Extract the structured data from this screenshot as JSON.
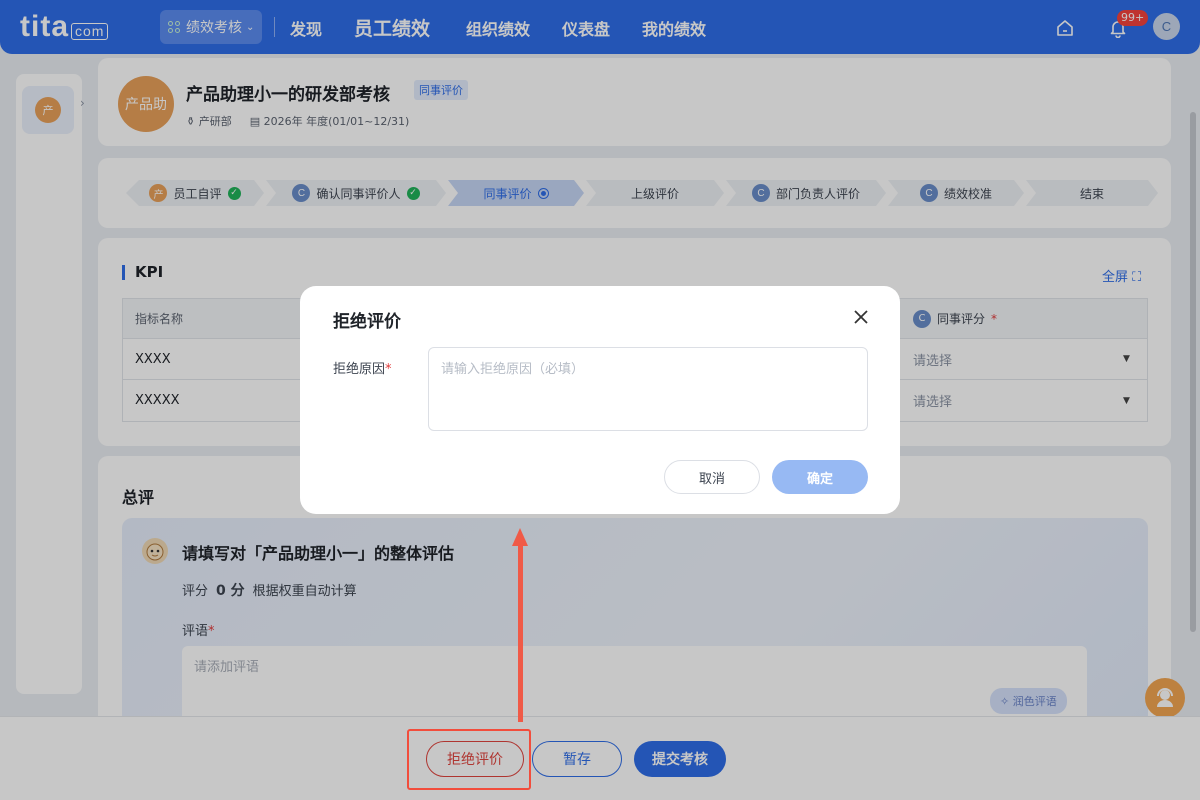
{
  "topnav": {
    "logo_text": "tita",
    "logo_suffix": "com",
    "switcher_label": "绩效考核",
    "items": [
      "发现",
      "员工绩效",
      "组织绩效",
      "仪表盘",
      "我的绩效"
    ],
    "notification_count": "99+",
    "user_initial": "C"
  },
  "sidebar": {
    "item_label": "产"
  },
  "header": {
    "avatar_text": "产品助",
    "title": "产品助理小一的研发部考核",
    "tag": "同事评价",
    "department": "产研部",
    "period": "2026年 年度(01/01~12/31)"
  },
  "steps": [
    {
      "label": "员工自评",
      "avatar": "产",
      "avatar_type": "orange",
      "status": "done"
    },
    {
      "label": "确认同事评价人",
      "avatar": "C",
      "avatar_type": "blue",
      "status": "done"
    },
    {
      "label": "同事评价",
      "avatar": "",
      "avatar_type": "none",
      "status": "active"
    },
    {
      "label": "上级评价",
      "avatar": "",
      "avatar_type": "none",
      "status": "pending"
    },
    {
      "label": "部门负责人评价",
      "avatar": "C",
      "avatar_type": "blue",
      "status": "pending"
    },
    {
      "label": "绩效校准",
      "avatar": "C",
      "avatar_type": "blue",
      "status": "pending"
    },
    {
      "label": "结束",
      "avatar": "",
      "avatar_type": "none",
      "status": "pending"
    }
  ],
  "kpi": {
    "title": "KPI",
    "fullscreen_label": "全屏",
    "columns": {
      "name": "指标名称",
      "score": "同事评分",
      "score_avatar": "C"
    },
    "rows": [
      {
        "name": "XXXX",
        "score_placeholder": "请选择"
      },
      {
        "name": "XXXXX",
        "score_placeholder": "请选择"
      }
    ]
  },
  "summary": {
    "title": "总评",
    "panel_title": "请填写对「产品助理小一」的整体评估",
    "score_label": "评分",
    "score_value": "0 分",
    "score_note": "根据权重自动计算",
    "comment_label": "评语",
    "comment_placeholder": "请添加评语",
    "polish_label": "润色评语"
  },
  "footer": {
    "reject_label": "拒绝评价",
    "save_label": "暂存",
    "submit_label": "提交考核"
  },
  "dialog": {
    "title": "拒绝评价",
    "reason_label": "拒绝原因",
    "reason_placeholder": "请输入拒绝原因（必填）",
    "cancel_label": "取消",
    "confirm_label": "确定"
  },
  "colors": {
    "brand": "#2f6ee8",
    "danger": "#e0443e",
    "annotation": "#f05a47"
  }
}
